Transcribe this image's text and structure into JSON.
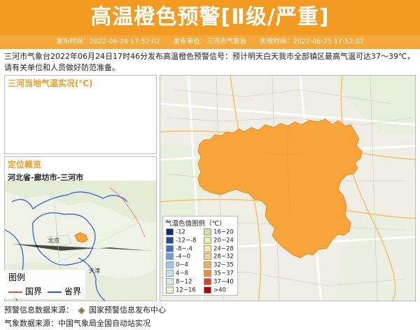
{
  "header": {
    "title": "高温橙色预警[Ⅱ级/严重]",
    "publish_time": "发布时间：2022-06-24 17:52:02",
    "publisher": "发布单位：三河市气象台",
    "expire_time": "失效时间：2022-06-25 17:52:02"
  },
  "description": "三河市气象台2022年06月24日17时46分发布高温橙色预警信号：预计明天白天我市全部镇区最高气温可达37～39℃，请有关单位和人员做好防范准备。",
  "temp_panel": {
    "title": "三河当地气温实况(℃)"
  },
  "location_panel": {
    "title": "定位概览",
    "region": "河北省-廊坊市-三河市",
    "map_labels": {
      "beijing": "北京",
      "tianjin": "天津"
    }
  },
  "boundary_legend": {
    "title": "图例",
    "items": [
      {
        "label": "国界",
        "color": "#d9534f"
      },
      {
        "label": "省界",
        "color": "#2a5bd7"
      }
    ]
  },
  "color_legend": {
    "title": "气温色值图例（℃）",
    "items": [
      {
        "label": "-12",
        "color": "#0a2a7a"
      },
      {
        "label": "16~20",
        "color": "#c8e6a0"
      },
      {
        "label": "-12~-8",
        "color": "#1e4aa8"
      },
      {
        "label": "20~24",
        "color": "#e8f0a0"
      },
      {
        "label": "-8~-4",
        "color": "#3a74c8"
      },
      {
        "label": "24~28",
        "color": "#f8e8a0"
      },
      {
        "label": "-4~0",
        "color": "#6aa0e0"
      },
      {
        "label": "28~32",
        "color": "#f8d080"
      },
      {
        "label": "0~4",
        "color": "#9cc8f0"
      },
      {
        "label": "32~35",
        "color": "#f4b060"
      },
      {
        "label": "4~8",
        "color": "#c0e0f8"
      },
      {
        "label": "35~37",
        "color": "#f08a3c"
      },
      {
        "label": "8~12",
        "color": "#d0f0d8"
      },
      {
        "label": "37~40",
        "color": "#e04020"
      },
      {
        "label": "12~16",
        "color": "#e0f4d0"
      },
      {
        "label": ">40",
        "color": "#b00010"
      }
    ]
  },
  "footer": {
    "warning_source": "预警信息数据来源：",
    "warning_source_name": "国家预警信息发布中心",
    "weather_source": "气象数据来源：中国气象局全国自动站实况"
  },
  "colors": {
    "accent": "#f39a21",
    "warning_area": "#f7a43a"
  }
}
